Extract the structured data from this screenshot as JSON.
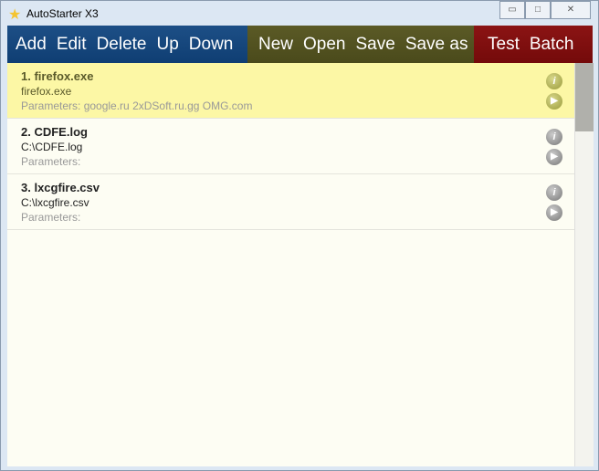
{
  "window": {
    "title": "AutoStarter X3",
    "minimize": "▭",
    "maximize": "□",
    "close": "✕"
  },
  "toolbar": {
    "list": [
      "Add",
      "Edit",
      "Delete",
      "Up",
      "Down"
    ],
    "file": [
      "New",
      "Open",
      "Save",
      "Save as"
    ],
    "run": [
      "Test",
      "Batch"
    ]
  },
  "items": [
    {
      "name": "1. firefox.exe",
      "path": "firefox.exe",
      "params": "Parameters: google.ru 2xDSoft.ru.gg OMG.com",
      "info": "i",
      "play": "▶"
    },
    {
      "name": "2. CDFE.log",
      "path": "C:\\CDFE.log",
      "params": "Parameters:",
      "info": "i",
      "play": "▶"
    },
    {
      "name": "3. lxcgfire.csv",
      "path": "C:\\lxcgfire.csv",
      "params": "Parameters:",
      "info": "i",
      "play": "▶"
    }
  ]
}
